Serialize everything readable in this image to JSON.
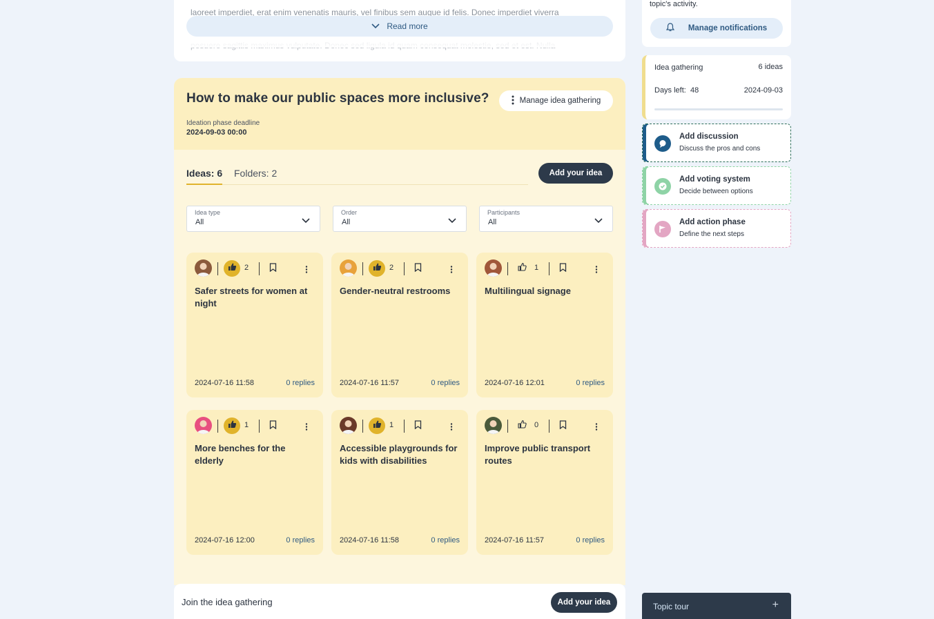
{
  "description": {
    "line1": "laoreet imperdiet, erat enim venenatis mauris, vel finibus sem augue id felis. Donec imperdiet viverra",
    "line2": "posuere sagittis maximus vulputate. Donec sed ligula id quam consequat molestie, sed et est. Nulla",
    "read_more_label": "Read more"
  },
  "idea_gathering": {
    "title": "How to make our public spaces more inclusive?",
    "manage_label": "Manage idea gathering",
    "deadline_label": "Ideation phase deadline",
    "deadline_value": "2024-09-03 00:00",
    "tabs": [
      {
        "label": "Ideas: 6",
        "active": true
      },
      {
        "label": "Folders: 2",
        "active": false
      }
    ],
    "add_idea_label": "Add your idea",
    "filters": [
      {
        "label": "Idea type",
        "value": "All"
      },
      {
        "label": "Order",
        "value": "All"
      },
      {
        "label": "Participants",
        "value": "All"
      }
    ],
    "ideas": [
      {
        "title": "Safer streets for women at night",
        "likes": "2",
        "liked": true,
        "date": "2024-07-16 11:58",
        "replies": "0 replies",
        "avatar_color": "#8b5a3c"
      },
      {
        "title": "Gender-neutral restrooms",
        "likes": "2",
        "liked": true,
        "date": "2024-07-16 11:57",
        "replies": "0 replies",
        "avatar_color": "#e8a23a"
      },
      {
        "title": "Multilingual signage",
        "likes": "1",
        "liked": false,
        "date": "2024-07-16 12:01",
        "replies": "0 replies",
        "avatar_color": "#a0573a"
      },
      {
        "title": "More benches for the elderly",
        "likes": "1",
        "liked": true,
        "date": "2024-07-16 12:00",
        "replies": "0 replies",
        "avatar_color": "#e84f7f"
      },
      {
        "title": "Accessible playgrounds for kids with disabilities",
        "likes": "1",
        "liked": true,
        "date": "2024-07-16 11:58",
        "replies": "0 replies",
        "avatar_color": "#6b3a2a"
      },
      {
        "title": "Improve public transport routes",
        "likes": "0",
        "liked": false,
        "date": "2024-07-16 11:57",
        "replies": "0 replies",
        "avatar_color": "#4a5a3a"
      }
    ]
  },
  "join": {
    "text": "Join the idea gathering",
    "button_label": "Add your idea"
  },
  "sidebar": {
    "notif_text": "topic's activity.",
    "notif_button_label": "Manage notifications",
    "ig_summary": {
      "label": "Idea gathering",
      "ideas_count": "6 ideas",
      "days_left_label": "Days left:",
      "days_left_value": "48",
      "deadline": "2024-09-03"
    },
    "actions": [
      {
        "title": "Add discussion",
        "subtitle": "Discuss the pros and cons",
        "color": "#1e5c8a",
        "icon": "chat-icon"
      },
      {
        "title": "Add voting system",
        "subtitle": "Decide between options",
        "color": "#8ed3a6",
        "icon": "check-icon"
      },
      {
        "title": "Add action phase",
        "subtitle": "Define the next steps",
        "color": "#e3a6c3",
        "icon": "flag-icon"
      }
    ],
    "tour_label": "Topic tour",
    "tour_icon": "plus-icon"
  },
  "colors": {
    "accent_dark": "#2d3a4a",
    "idea_yellow": "#fcefc0",
    "like_active": "#e0b32b",
    "link_blue": "#2f5a82"
  }
}
